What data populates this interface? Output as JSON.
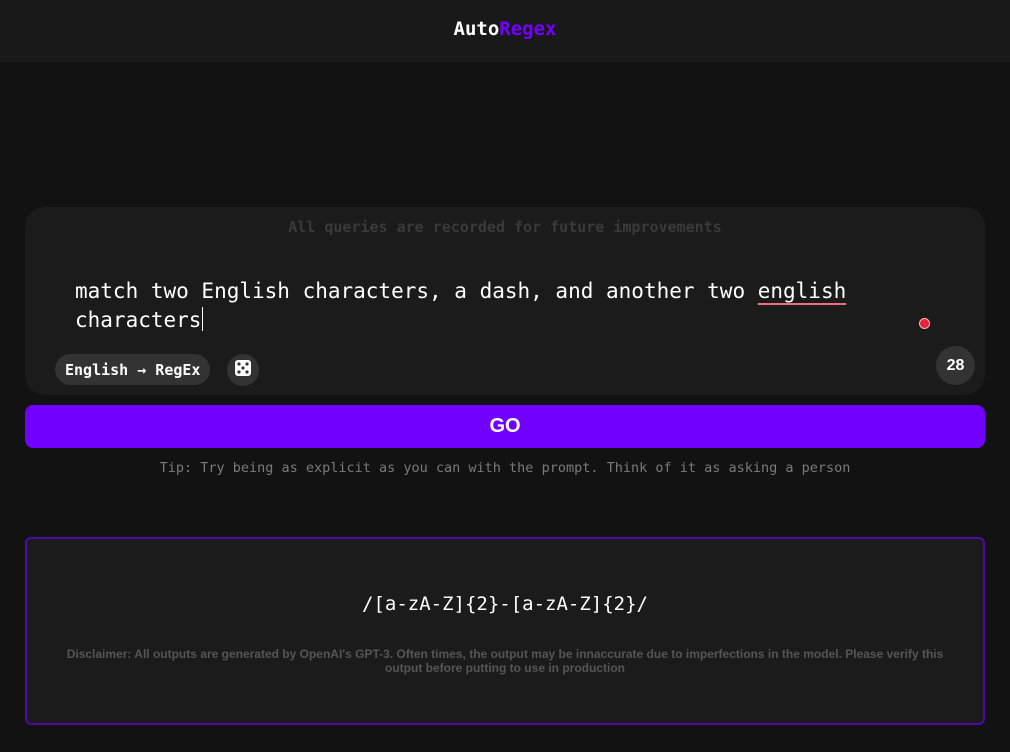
{
  "header": {
    "logo_part1": "Auto",
    "logo_part2": "Regex"
  },
  "query": {
    "notice": "All queries are recorded for future improvements",
    "text_before": "match two English characters, a dash, and another two ",
    "text_misspelled": "english",
    "text_after": "\ncharacters",
    "mode_label": "English → RegEx",
    "dice_icon": "dice-icon",
    "count": "28"
  },
  "go_button": {
    "label": "GO"
  },
  "tip": "Tip: Try being as explicit as you can with the prompt. Think of it as asking a person",
  "result": {
    "regex": "/[a-zA-Z]{2}-[a-zA-Z]{2}/",
    "disclaimer": "Disclaimer: All outputs are generated by OpenAI's GPT-3. Often times, the output may be innaccurate due to imperfections in the model. Please verify this output before putting to use in production"
  },
  "colors": {
    "accent": "#7100ff",
    "background": "#121212",
    "card": "#1b1b1b",
    "result_border": "#4a0aa6",
    "recording_dot": "#e8223a"
  }
}
